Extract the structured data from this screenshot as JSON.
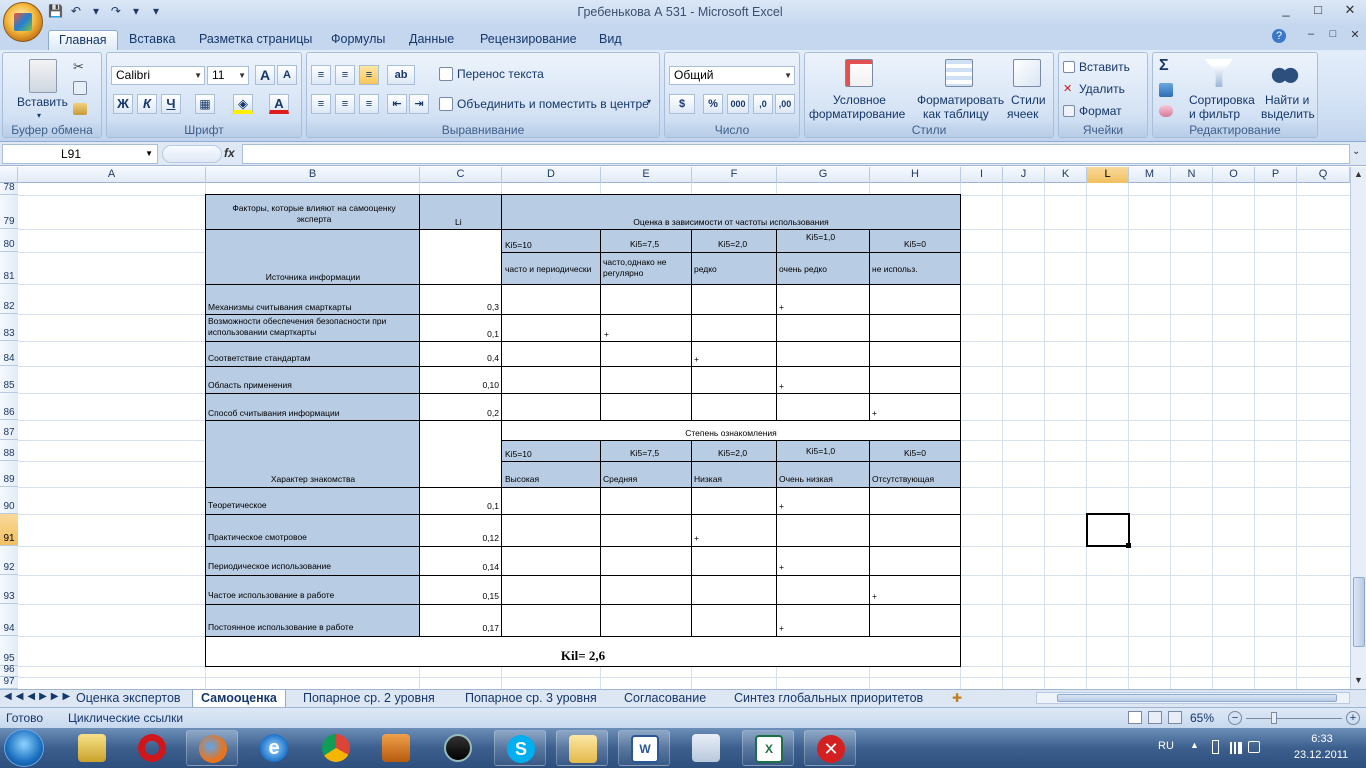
{
  "window": {
    "title": "Гребенькова А 531 - Microsoft Excel",
    "controls": [
      "_",
      "□",
      "✕"
    ],
    "doc_controls": [
      "–",
      "□",
      "✕"
    ]
  },
  "qat": [
    "💾",
    "↶",
    "▾",
    "↷",
    "▾",
    "▾"
  ],
  "tabs": [
    "Главная",
    "Вставка",
    "Разметка страницы",
    "Формулы",
    "Данные",
    "Рецензирование",
    "Вид"
  ],
  "ribbon": {
    "clipboard": {
      "label": "Буфер обмена",
      "paste": "Вставить"
    },
    "font": {
      "label": "Шрифт",
      "name": "Calibri",
      "size": "11",
      "bold": "Ж",
      "italic": "К",
      "underline": "Ч"
    },
    "alignment": {
      "label": "Выравнивание",
      "wrap": "Перенос текста",
      "merge": "Объединить и поместить в центре"
    },
    "number": {
      "label": "Число",
      "format": "Общий",
      "percent": "%",
      "thousands": "000"
    },
    "styles": {
      "label": "Стили",
      "conditional": [
        "Условное",
        "форматирование"
      ],
      "format_table": [
        "Форматировать",
        "как таблицу"
      ],
      "cell_styles": [
        "Стили",
        "ячеек"
      ]
    },
    "cells": {
      "label": "Ячейки",
      "insert": "Вставить",
      "delete": "Удалить",
      "format": "Формат"
    },
    "editing": {
      "label": "Редактирование",
      "sort": [
        "Сортировка",
        "и фильтр"
      ],
      "find": [
        "Найти и",
        "выделить"
      ]
    }
  },
  "formula_bar": {
    "name_box": "L91",
    "fx": "fx",
    "formula": ""
  },
  "columns": [
    "A",
    "B",
    "C",
    "D",
    "E",
    "F",
    "G",
    "H",
    "I",
    "J",
    "K",
    "L",
    "M",
    "N",
    "O",
    "P",
    "Q"
  ],
  "rows": [
    "78",
    "79",
    "80",
    "81",
    "82",
    "83",
    "84",
    "85",
    "86",
    "87",
    "88",
    "89",
    "90",
    "91",
    "92",
    "93",
    "94",
    "95",
    "96",
    "97"
  ],
  "sheet": {
    "header_factors": "Факторы, которые влияют на самооценку эксперта",
    "header_li": "Li",
    "header_rating": "Оценка в зависимости от частоты  использования",
    "sources_label": "Источника информации",
    "k_labels": [
      "Ki5=10",
      "Ki5=7,5",
      "Ki5=2,0",
      "Ki5=1,0",
      "Ki5=0"
    ],
    "freq_labels": [
      "часто и периодически",
      "часто,однако не регулярно",
      "редко",
      "очень редко",
      "не использ."
    ],
    "sources": [
      {
        "name": "Механизмы считывания смарткарты",
        "li": "0,3",
        "mark_col": 3
      },
      {
        "name": "Возможности обеспечения безопасности при использовании смарткарты",
        "li": "0,1",
        "mark_col": 1
      },
      {
        "name": "Соответствие стандартам",
        "li": "0,4",
        "mark_col": 2
      },
      {
        "name": "Область применения",
        "li": "0,10",
        "mark_col": 3
      },
      {
        "name": "Способ считывания информации",
        "li": "0,2",
        "mark_col": 4
      }
    ],
    "familiarity_title": "Степень ознакомления",
    "familiarity_label": "Характер знакомства",
    "level_labels": [
      "Высокая",
      "Средняя",
      "Низкая",
      "Очень низкая",
      "Отсутствующая"
    ],
    "familiarity": [
      {
        "name": "Теоретическое",
        "li": "0,1",
        "mark_col": 3
      },
      {
        "name": "Практическое смотровое",
        "li": "0,12",
        "mark_col": 2
      },
      {
        "name": "Периодическое использование",
        "li": "0,14",
        "mark_col": 3
      },
      {
        "name": "Частое  использование в работе",
        "li": "0,15",
        "mark_col": 4
      },
      {
        "name": "Постоянное использование в работе",
        "li": "0,17",
        "mark_col": 3
      }
    ],
    "mark": "+",
    "result": "Kil= 2,6"
  },
  "sheet_tabs": [
    "Оценка экспертов",
    "Самооценка",
    "Попарное ср. 2 уровня",
    "Попарное ср. 3 уровня",
    "Согласование",
    "Синтез глобальных приоритетов"
  ],
  "status": {
    "ready": "Готово",
    "circular": "Циклические ссылки",
    "zoom": "65%"
  },
  "taskbar": {
    "lang": "RU",
    "time": "6:33",
    "date": "23.12.2011"
  },
  "colors": {
    "accent": "#b8cce4",
    "ribbon": "#cfdff3",
    "selection": "#f1c15f"
  }
}
